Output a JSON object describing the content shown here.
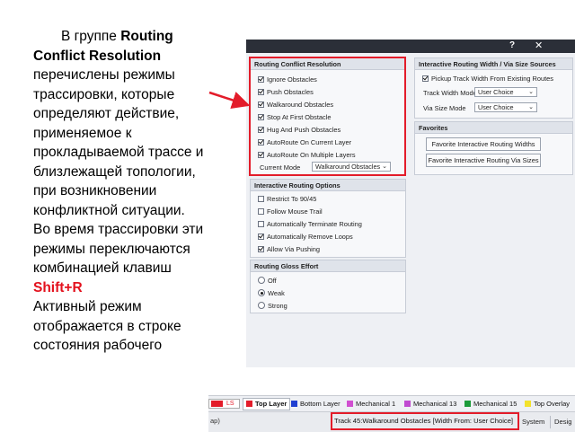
{
  "slide_text": {
    "line_1": "В группе ",
    "bold_1": "Routing Conflict Resolution",
    "line_2": " перечислены режимы трассировки, которые определяют действие, применяемое к прокладываемой трассе и близлежащей топологии, при возникновении конфликтной ситуации.",
    "line_3": "Во время трассировки эти режимы переключаются комбинацией клавиш ",
    "hotkey": "Shift+R",
    "line_4": "Активный режим отображается в строке состояния рабочего"
  },
  "dialog": {
    "help_glyph": "?",
    "close_glyph": "✕",
    "conflict_group": {
      "title": "Routing Conflict Resolution",
      "options": [
        {
          "label": "Ignore Obstacles",
          "checked": true
        },
        {
          "label": "Push Obstacles",
          "checked": true
        },
        {
          "label": "Walkaround Obstacles",
          "checked": true
        },
        {
          "label": "Stop At First Obstacle",
          "checked": true
        },
        {
          "label": "Hug And Push Obstacles",
          "checked": true
        },
        {
          "label": "AutoRoute On Current Layer",
          "checked": true
        },
        {
          "label": "AutoRoute On Multiple Layers",
          "checked": true
        }
      ],
      "current_mode_label": "Current Mode",
      "current_mode_value": "Walkaround Obstacles"
    },
    "options_group": {
      "title": "Interactive Routing Options",
      "options": [
        {
          "label": "Restrict To 90/45",
          "checked": false
        },
        {
          "label": "Follow Mouse Trail",
          "checked": false
        },
        {
          "label": "Automatically Terminate Routing",
          "checked": false
        },
        {
          "label": "Automatically Remove Loops",
          "checked": true
        },
        {
          "label": "Allow Via Pushing",
          "checked": true
        }
      ]
    },
    "gloss_group": {
      "title": "Routing Gloss Effort",
      "options": [
        {
          "label": "Off",
          "selected": false
        },
        {
          "label": "Weak",
          "selected": true
        },
        {
          "label": "Strong",
          "selected": false
        }
      ]
    },
    "width_group": {
      "title": "Interactive Routing Width / Via Size Sources",
      "pickup_label": "Pickup Track Width From Existing Routes",
      "pickup_checked": true,
      "track_width_mode_label": "Track Width Mode",
      "track_width_mode_value": "User Choice",
      "via_size_mode_label": "Via Size Mode",
      "via_size_mode_value": "User Choice"
    },
    "favorites_group": {
      "title": "Favorites",
      "button_1": "Favorite Interactive Routing Widths",
      "button_2": "Favorite Interactive Routing Via Sizes"
    }
  },
  "layer_strip": {
    "ls_label": "LS",
    "layers": [
      {
        "label": "Top Layer",
        "color": "#e31c2a",
        "active": true
      },
      {
        "label": "Bottom Layer",
        "color": "#1f3fd1",
        "active": false
      },
      {
        "label": "Mechanical 1",
        "color": "#d14fd1",
        "active": false
      },
      {
        "label": "Mechanical 13",
        "color": "#c04ad1",
        "active": false
      },
      {
        "label": "Mechanical 15",
        "color": "#1b9b3a",
        "active": false
      },
      {
        "label": "Top Overlay",
        "color": "#f3e22b",
        "active": false
      }
    ]
  },
  "status_bar": {
    "left_fragment": "ap)",
    "track_text": "Track 45:Walkaround Obstacles [Width From: User Choice]",
    "tab_system": "System",
    "tab_design": "Desig"
  },
  "colors": {
    "highlight_red": "#e31c2a",
    "title_bar": "#2b2f38"
  }
}
